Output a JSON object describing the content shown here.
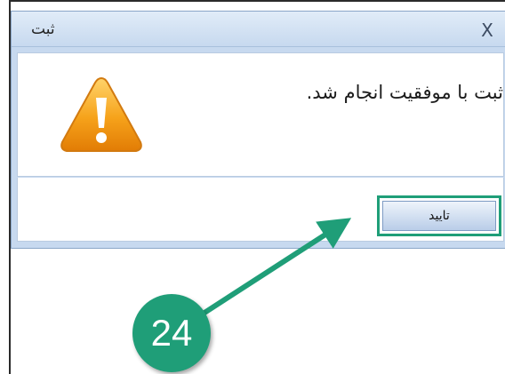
{
  "dialog": {
    "title": "ثبت",
    "close_label": "X",
    "message": "ثبت با موفقیت انجام شد.",
    "ok_label": "تایید"
  },
  "annotation": {
    "step_number": "24",
    "accent_color": "#1f9e78"
  },
  "icons": {
    "warning": "warning-triangle-icon",
    "close": "close-icon"
  },
  "colors": {
    "warning_fill": "#f6a21a",
    "titlebar": "#c7d9ef"
  }
}
